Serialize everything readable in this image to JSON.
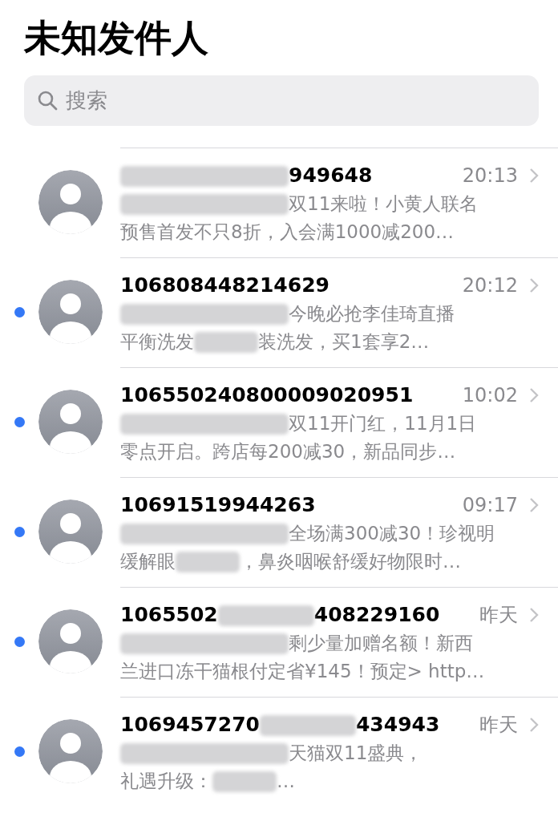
{
  "title": "未知发件人",
  "search": {
    "placeholder": "搜索"
  },
  "messages": [
    {
      "unread": false,
      "time": "20:13",
      "sender": [
        {
          "kind": "redaction"
        },
        {
          "kind": "text",
          "text": "949648"
        }
      ],
      "lines": [
        [
          {
            "kind": "redaction"
          },
          {
            "kind": "text",
            "text": "双11来啦！小黄人联名"
          }
        ],
        [
          {
            "kind": "text",
            "text": "预售首发不只8折，入会满1000减200…"
          }
        ]
      ]
    },
    {
      "unread": true,
      "time": "20:12",
      "sender": [
        {
          "kind": "text",
          "text": "106808448214629"
        }
      ],
      "lines": [
        [
          {
            "kind": "redaction"
          },
          {
            "kind": "text",
            "text": "今晚必抢李佳琦直播"
          }
        ],
        [
          {
            "kind": "text",
            "text": "平衡洗发"
          },
          {
            "kind": "redaction"
          },
          {
            "kind": "text",
            "text": "装洗发，买1套享2…"
          }
        ]
      ]
    },
    {
      "unread": true,
      "time": "10:02",
      "sender": [
        {
          "kind": "text",
          "text": "106550240800009020951"
        }
      ],
      "lines": [
        [
          {
            "kind": "redaction"
          },
          {
            "kind": "text",
            "text": "双11开门红，11月1日"
          }
        ],
        [
          {
            "kind": "text",
            "text": "零点开启。跨店每200减30，新品同步…"
          }
        ]
      ]
    },
    {
      "unread": true,
      "time": "09:17",
      "sender": [
        {
          "kind": "text",
          "text": "10691519944263"
        }
      ],
      "lines": [
        [
          {
            "kind": "redaction"
          },
          {
            "kind": "text",
            "text": "全场满300减30！珍视明"
          }
        ],
        [
          {
            "kind": "text",
            "text": "缓解眼"
          },
          {
            "kind": "redaction"
          },
          {
            "kind": "text",
            "text": "，鼻炎咽喉舒缓好物限时…"
          }
        ]
      ]
    },
    {
      "unread": true,
      "time": "昨天",
      "sender": [
        {
          "kind": "text",
          "text": "1065502"
        },
        {
          "kind": "redaction"
        },
        {
          "kind": "text",
          "text": "408229160"
        }
      ],
      "lines": [
        [
          {
            "kind": "redaction"
          },
          {
            "kind": "text",
            "text": "剩少量加赠名额！新西"
          }
        ],
        [
          {
            "kind": "text",
            "text": "兰进口冻干猫根付定省¥145！预定> http…"
          }
        ]
      ]
    },
    {
      "unread": true,
      "time": "昨天",
      "sender": [
        {
          "kind": "text",
          "text": "1069457270"
        },
        {
          "kind": "redaction"
        },
        {
          "kind": "text",
          "text": "434943"
        }
      ],
      "lines": [
        [
          {
            "kind": "redaction"
          },
          {
            "kind": "text",
            "text": "天猫双11盛典，"
          }
        ],
        [
          {
            "kind": "text",
            "text": "礼遇升级："
          },
          {
            "kind": "redaction"
          },
          {
            "kind": "text",
            "text": "…"
          }
        ]
      ]
    }
  ]
}
